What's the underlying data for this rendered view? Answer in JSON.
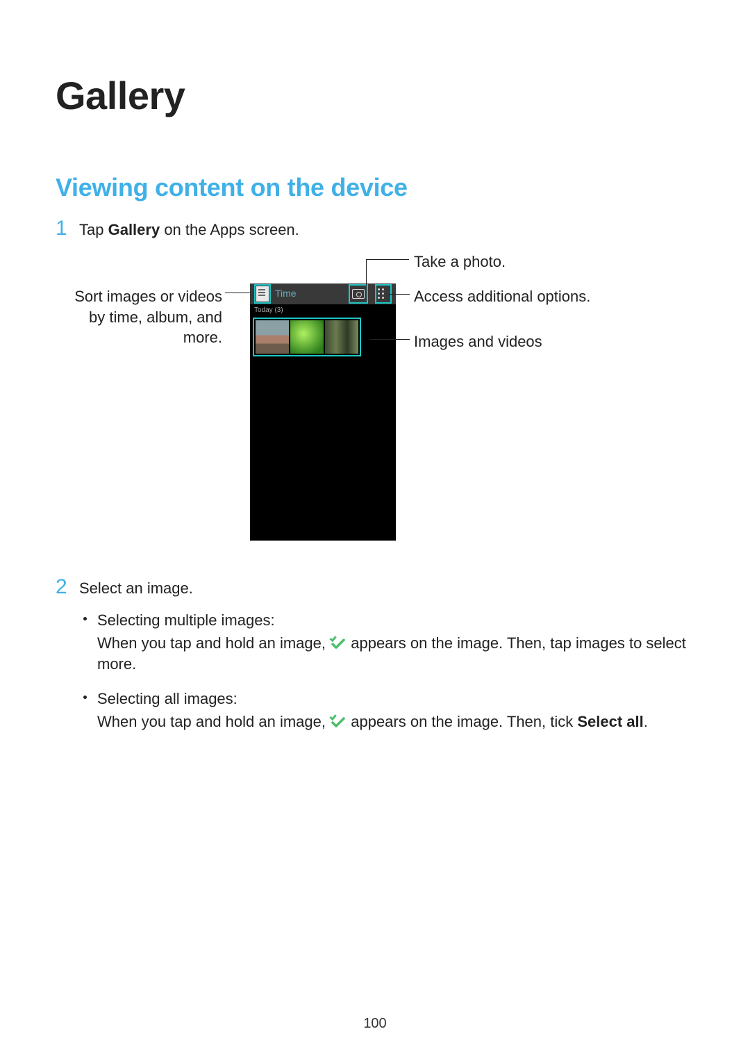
{
  "title": "Gallery",
  "section_heading": "Viewing content on the device",
  "steps": {
    "step1": {
      "num": "1",
      "pre": "Tap ",
      "bold": "Gallery",
      "post": " on the Apps screen."
    },
    "step2": {
      "num": "2",
      "text": "Select an image."
    }
  },
  "callouts": {
    "sort": "Sort images or videos by time, album, and more.",
    "take_photo": "Take a photo.",
    "options": "Access additional options.",
    "thumbs": "Images and videos"
  },
  "phone": {
    "time_label": "Time",
    "today_label": "Today (3)"
  },
  "sub": {
    "multi_title": "Selecting multiple images:",
    "multi_pre": "When you tap and hold an image, ",
    "multi_post": " appears on the image. Then, tap images to select more.",
    "all_title": "Selecting all images:",
    "all_pre": "When you tap and hold an image, ",
    "all_post_a": " appears on the image. Then, tick ",
    "all_bold": "Select all",
    "all_post_b": "."
  },
  "page_number": "100"
}
